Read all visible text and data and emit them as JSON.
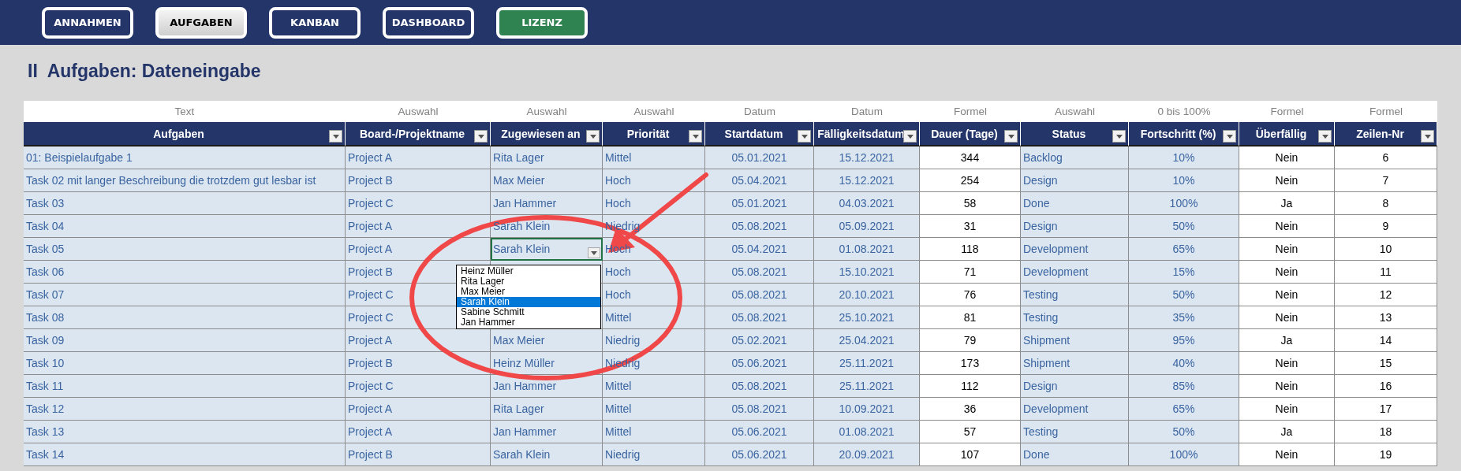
{
  "nav": [
    {
      "label": "ANNAHMEN",
      "selected": false,
      "kind": "page"
    },
    {
      "label": "AUFGABEN",
      "selected": true,
      "kind": "page"
    },
    {
      "label": "KANBAN",
      "selected": false,
      "kind": "page"
    },
    {
      "label": "DASHBOARD",
      "selected": false,
      "kind": "page"
    },
    {
      "label": "LIZENZ",
      "selected": false,
      "kind": "license"
    }
  ],
  "title": "II  Aufgaben: Dateneingabe",
  "table": {
    "columns": [
      {
        "hint": "Text",
        "label": "Aufgaben",
        "kind": "text"
      },
      {
        "hint": "Auswahl",
        "label": "Board-/Projektname",
        "kind": "text"
      },
      {
        "hint": "Auswahl",
        "label": "Zugewiesen an",
        "kind": "text"
      },
      {
        "hint": "Auswahl",
        "label": "Priorität",
        "kind": "text"
      },
      {
        "hint": "Datum",
        "label": "Startdatum",
        "kind": "date"
      },
      {
        "hint": "Datum",
        "label": "Fälligkeitsdatum",
        "kind": "date"
      },
      {
        "hint": "Formel",
        "label": "Dauer (Tage)",
        "kind": "number"
      },
      {
        "hint": "Auswahl",
        "label": "Status",
        "kind": "text"
      },
      {
        "hint": "0 bis 100%",
        "label": "Fortschritt (%)",
        "kind": "date"
      },
      {
        "hint": "Formel",
        "label": "Überfällig",
        "kind": "number"
      },
      {
        "hint": "Formel",
        "label": "Zeilen-Nr",
        "kind": "number"
      }
    ],
    "rows": [
      {
        "selected": false,
        "cells": [
          "01: Beispielaufgabe 1",
          "Project A",
          "Rita Lager",
          "Mittel",
          "05.01.2021",
          "15.12.2021",
          "344",
          "Backlog",
          "10%",
          "Nein",
          "6"
        ]
      },
      {
        "selected": false,
        "cells": [
          "Task 02 mit langer Beschreibung die trotzdem gut lesbar ist",
          "Project B",
          "Max Meier",
          "Hoch",
          "05.04.2021",
          "15.12.2021",
          "254",
          "Design",
          "10%",
          "Nein",
          "7"
        ]
      },
      {
        "selected": false,
        "cells": [
          "Task 03",
          "Project C",
          "Jan Hammer",
          "Hoch",
          "05.01.2021",
          "04.03.2021",
          "58",
          "Done",
          "100%",
          "Ja",
          "8"
        ]
      },
      {
        "selected": false,
        "cells": [
          "Task 04",
          "Project A",
          "Sarah Klein",
          "Niedrig",
          "05.08.2021",
          "05.09.2021",
          "31",
          "Design",
          "50%",
          "Nein",
          "9"
        ]
      },
      {
        "selected": true,
        "cells": [
          "Task 05",
          "Project A",
          "Sarah Klein",
          "Hoch",
          "05.04.2021",
          "01.08.2021",
          "118",
          "Development",
          "65%",
          "Nein",
          "10"
        ]
      },
      {
        "selected": false,
        "cells": [
          "Task 06",
          "Project B",
          null,
          "Hoch",
          "05.08.2021",
          "15.10.2021",
          "71",
          "Development",
          "15%",
          "Nein",
          "11"
        ]
      },
      {
        "selected": false,
        "cells": [
          "Task 07",
          "Project C",
          null,
          "Hoch",
          "05.08.2021",
          "20.10.2021",
          "76",
          "Testing",
          "50%",
          "Nein",
          "12"
        ]
      },
      {
        "selected": false,
        "cells": [
          "Task 08",
          "Project C",
          null,
          "Mittel",
          "05.08.2021",
          "25.10.2021",
          "81",
          "Testing",
          "35%",
          "Nein",
          "13"
        ]
      },
      {
        "selected": false,
        "cells": [
          "Task 09",
          "Project A",
          "Max Meier",
          "Niedrig",
          "05.02.2021",
          "25.04.2021",
          "79",
          "Shipment",
          "95%",
          "Ja",
          "14"
        ]
      },
      {
        "selected": false,
        "cells": [
          "Task 10",
          "Project B",
          "Heinz Müller",
          "Niedrig",
          "05.06.2021",
          "25.11.2021",
          "173",
          "Shipment",
          "40%",
          "Nein",
          "15"
        ]
      },
      {
        "selected": false,
        "cells": [
          "Task 11",
          "Project C",
          "Jan Hammer",
          "Mittel",
          "05.08.2021",
          "25.11.2021",
          "112",
          "Design",
          "85%",
          "Nein",
          "16"
        ]
      },
      {
        "selected": false,
        "cells": [
          "Task 12",
          "Project A",
          "Rita Lager",
          "Mittel",
          "05.08.2021",
          "10.09.2021",
          "36",
          "Development",
          "65%",
          "Nein",
          "17"
        ]
      },
      {
        "selected": false,
        "cells": [
          "Task 13",
          "Project A",
          "Jan Hammer",
          "Mittel",
          "05.06.2021",
          "01.08.2021",
          "57",
          "Testing",
          "50%",
          "Ja",
          "18"
        ]
      },
      {
        "selected": false,
        "cells": [
          "Task 14",
          "Project B",
          "Sarah Klein",
          "Niedrig",
          "05.06.2021",
          "20.09.2021",
          "107",
          "Done",
          "100%",
          "Nein",
          "19"
        ]
      }
    ]
  },
  "dropdown": {
    "items": [
      {
        "label": "Heinz Müller",
        "selected": false
      },
      {
        "label": "Rita Lager",
        "selected": false
      },
      {
        "label": "Max Meier",
        "selected": false
      },
      {
        "label": "Sarah Klein",
        "selected": true
      },
      {
        "label": "Sabine Schmitt",
        "selected": false
      },
      {
        "label": "Jan Hammer",
        "selected": false
      }
    ]
  }
}
